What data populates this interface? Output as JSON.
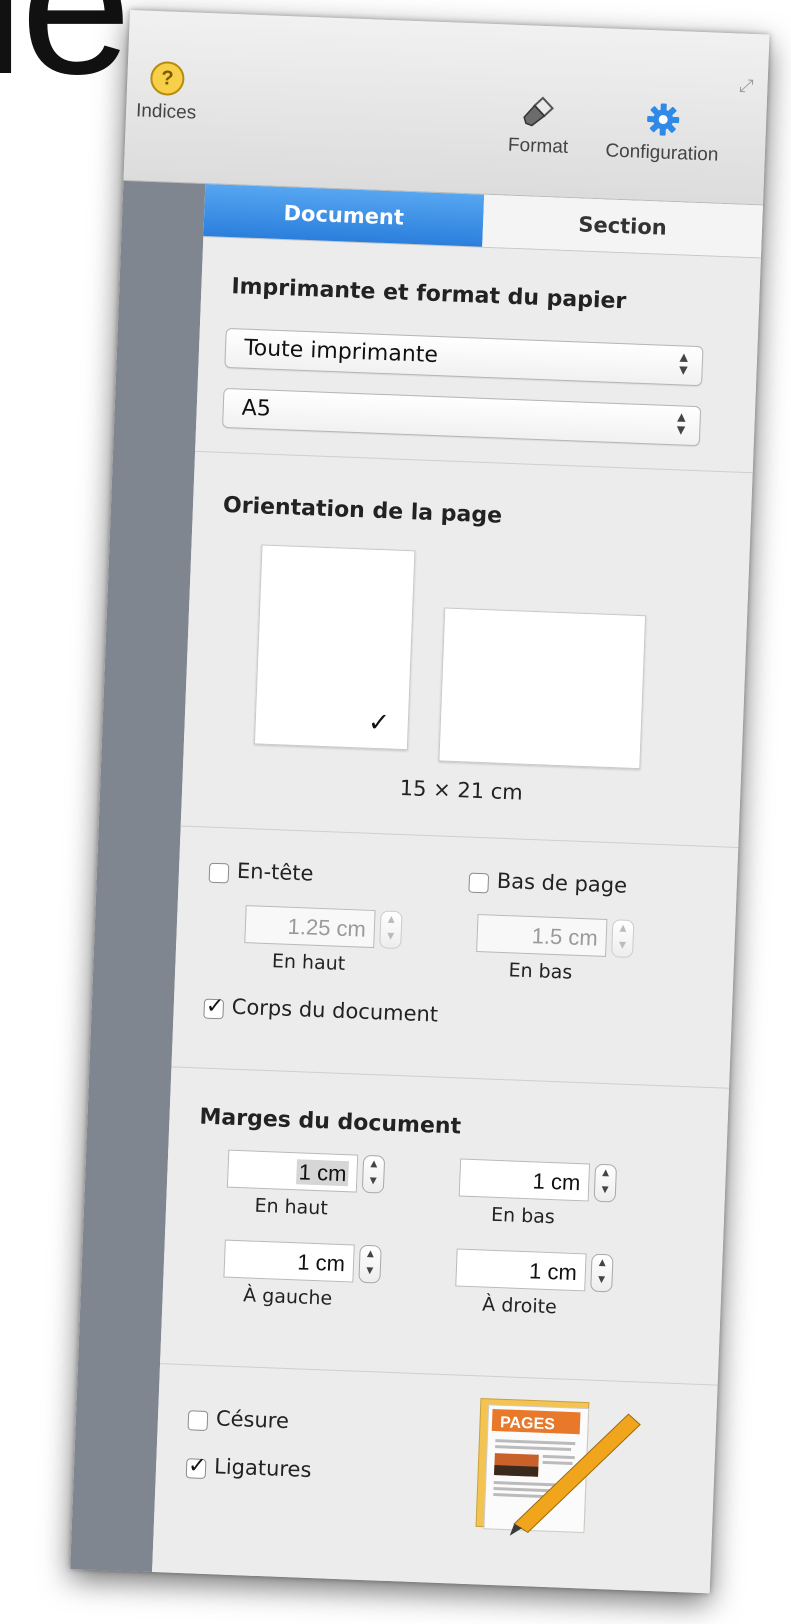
{
  "background_text": "le",
  "toolbar": {
    "hints_label": "Indices",
    "format_label": "Format",
    "config_label": "Configuration"
  },
  "tabs": [
    {
      "label": "Document",
      "active": true
    },
    {
      "label": "Section",
      "active": false
    }
  ],
  "printer_section": {
    "title": "Imprimante et format du papier",
    "printer_value": "Toute imprimante",
    "paper_value": "A5"
  },
  "orientation": {
    "title": "Orientation de la page",
    "selected": "portrait",
    "size_label": "15 × 21 cm"
  },
  "header_footer": {
    "header_label": "En-tête",
    "header_checked": false,
    "header_value": "1.25 cm",
    "header_caption": "En haut",
    "footer_label": "Bas de page",
    "footer_checked": false,
    "footer_value": "1.5 cm",
    "footer_caption": "En bas",
    "body_label": "Corps du document",
    "body_checked": true
  },
  "margins": {
    "title": "Marges du document",
    "top_value": "1 cm",
    "top_caption": "En haut",
    "bottom_value": "1 cm",
    "bottom_caption": "En bas",
    "left_value": "1 cm",
    "left_caption": "À gauche",
    "right_value": "1 cm",
    "right_caption": "À droite"
  },
  "hyphenation": {
    "hyphen_label": "Césure",
    "hyphen_checked": false,
    "ligatures_label": "Ligatures",
    "ligatures_checked": true
  },
  "app_icon": {
    "name": "pages-app-icon",
    "label": "PAGES",
    "accent": "#e8792b"
  },
  "colors": {
    "tab_active": "#2b7fdc",
    "help_icon": "#f7cf49",
    "config_icon": "#2e8ae6",
    "sidebar": "#7f868f"
  }
}
